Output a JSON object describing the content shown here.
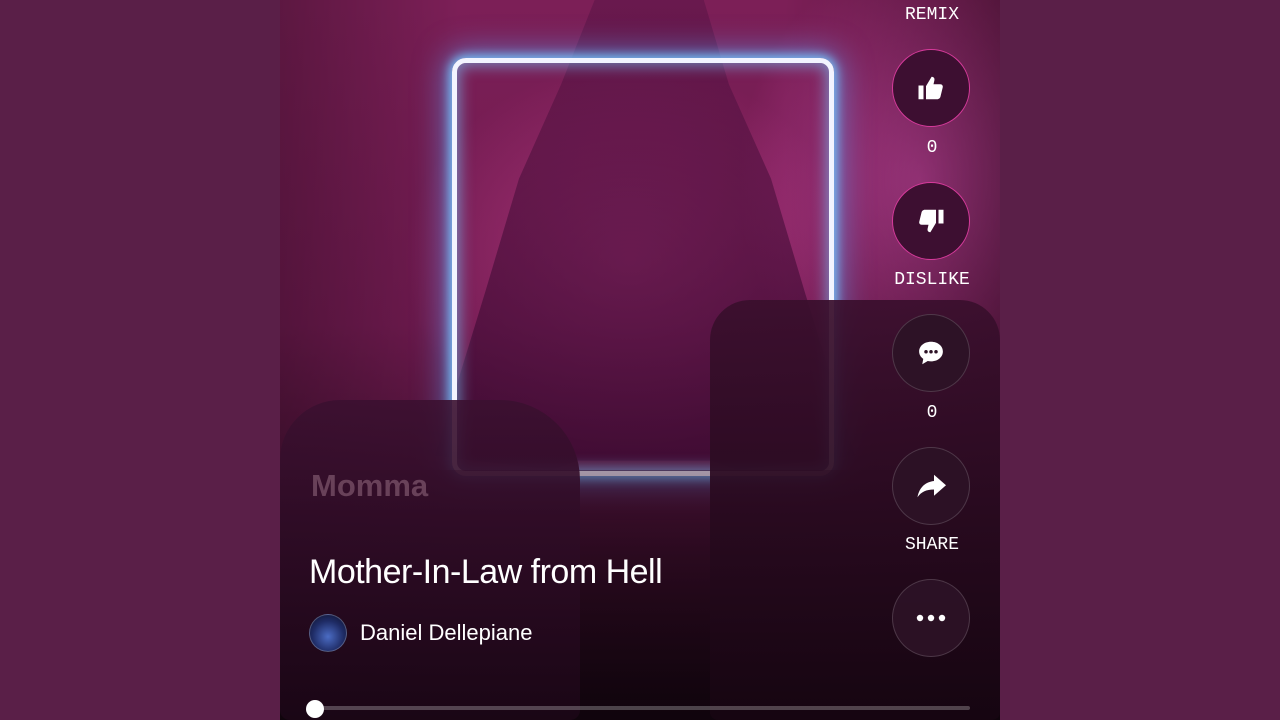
{
  "video": {
    "watermark_text": "Momma",
    "title": "Mother-In-Law from Hell",
    "author": "Daniel Dellepiane",
    "progress": 0
  },
  "actions": {
    "remix_label": "REMIX",
    "like_count": "0",
    "dislike_label": "DISLIKE",
    "comment_count": "0",
    "share_label": "SHARE"
  },
  "icons": {
    "like": "thumbs-up-icon",
    "dislike": "thumbs-down-icon",
    "comment": "comment-icon",
    "share": "share-arrow-icon",
    "more": "more-dots-icon"
  },
  "colors": {
    "page_background": "#5a1f48",
    "like_button_border": "#d63a9b",
    "text": "#ffffff"
  }
}
